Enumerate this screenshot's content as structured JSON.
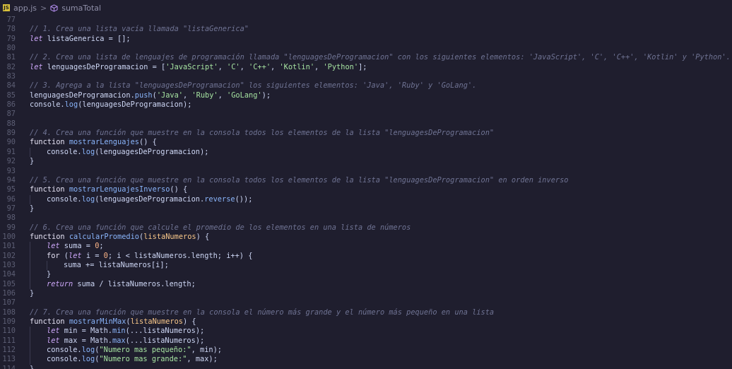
{
  "breadcrumb": {
    "file_icon": "JS",
    "file": "app.js",
    "separator": ">",
    "symbol": "sumaTotal"
  },
  "lines": [
    {
      "n": "77",
      "indent": 0,
      "tokens": []
    },
    {
      "n": "78",
      "indent": 0,
      "tokens": [
        {
          "t": "// 1. Crea una lista vacía llamada \"listaGenerica\"",
          "c": "comment"
        }
      ]
    },
    {
      "n": "79",
      "indent": 0,
      "tokens": [
        {
          "t": "let",
          "c": "kw"
        },
        {
          "t": " listaGenerica = [];",
          "c": "txt"
        }
      ]
    },
    {
      "n": "80",
      "indent": 0,
      "tokens": []
    },
    {
      "n": "81",
      "indent": 0,
      "tokens": [
        {
          "t": "// 2. Crea una lista de lenguajes de programación llamada \"lenguagesDeProgramacion\" con los siguientes elementos: 'JavaScript', 'C', 'C++', 'Kotlin' y 'Python'.",
          "c": "comment"
        }
      ]
    },
    {
      "n": "82",
      "indent": 0,
      "tokens": [
        {
          "t": "let",
          "c": "kw"
        },
        {
          "t": " lenguagesDeProgramacion = [",
          "c": "txt"
        },
        {
          "t": "'JavaScript'",
          "c": "str"
        },
        {
          "t": ", ",
          "c": "txt"
        },
        {
          "t": "'C'",
          "c": "str"
        },
        {
          "t": ", ",
          "c": "txt"
        },
        {
          "t": "'C++'",
          "c": "str"
        },
        {
          "t": ", ",
          "c": "txt"
        },
        {
          "t": "'Kotlin'",
          "c": "str"
        },
        {
          "t": ", ",
          "c": "txt"
        },
        {
          "t": "'Python'",
          "c": "str"
        },
        {
          "t": "];",
          "c": "txt"
        }
      ]
    },
    {
      "n": "83",
      "indent": 0,
      "tokens": []
    },
    {
      "n": "84",
      "indent": 0,
      "tokens": [
        {
          "t": "// 3. Agrega a la lista \"lenguagesDeProgramacion\" los siguientes elementos: 'Java', 'Ruby' y 'GoLang'.",
          "c": "comment"
        }
      ]
    },
    {
      "n": "85",
      "indent": 0,
      "tokens": [
        {
          "t": "lenguagesDeProgramacion.",
          "c": "txt"
        },
        {
          "t": "push",
          "c": "method"
        },
        {
          "t": "(",
          "c": "txt"
        },
        {
          "t": "'Java'",
          "c": "str"
        },
        {
          "t": ", ",
          "c": "txt"
        },
        {
          "t": "'Ruby'",
          "c": "str"
        },
        {
          "t": ", ",
          "c": "txt"
        },
        {
          "t": "'GoLang'",
          "c": "str"
        },
        {
          "t": ");",
          "c": "txt"
        }
      ]
    },
    {
      "n": "86",
      "indent": 0,
      "tokens": [
        {
          "t": "console.",
          "c": "txt"
        },
        {
          "t": "log",
          "c": "method"
        },
        {
          "t": "(lenguagesDeProgramacion);",
          "c": "txt"
        }
      ]
    },
    {
      "n": "87",
      "indent": 0,
      "tokens": []
    },
    {
      "n": "88",
      "indent": 0,
      "tokens": []
    },
    {
      "n": "89",
      "indent": 0,
      "tokens": [
        {
          "t": "// 4. Crea una función que muestre en la consola todos los elementos de la lista \"lenguagesDeProgramacion\"",
          "c": "comment"
        }
      ]
    },
    {
      "n": "90",
      "indent": 0,
      "tokens": [
        {
          "t": "function",
          "c": "kw-plain"
        },
        {
          "t": " ",
          "c": "txt"
        },
        {
          "t": "mostrarLenguajes",
          "c": "fn"
        },
        {
          "t": "() {",
          "c": "txt"
        }
      ]
    },
    {
      "n": "91",
      "indent": 1,
      "tokens": [
        {
          "t": "console.",
          "c": "txt"
        },
        {
          "t": "log",
          "c": "method"
        },
        {
          "t": "(lenguagesDeProgramacion);",
          "c": "txt"
        }
      ]
    },
    {
      "n": "92",
      "indent": 0,
      "tokens": [
        {
          "t": "}",
          "c": "txt"
        }
      ]
    },
    {
      "n": "93",
      "indent": 0,
      "tokens": []
    },
    {
      "n": "94",
      "indent": 0,
      "tokens": [
        {
          "t": "// 5. Crea una función que muestre en la consola todos los elementos de la lista \"lenguagesDeProgramacion\" en orden inverso",
          "c": "comment"
        }
      ]
    },
    {
      "n": "95",
      "indent": 0,
      "tokens": [
        {
          "t": "function",
          "c": "kw-plain"
        },
        {
          "t": " ",
          "c": "txt"
        },
        {
          "t": "mostrarLenguajesInverso",
          "c": "fn"
        },
        {
          "t": "() {",
          "c": "txt"
        }
      ]
    },
    {
      "n": "96",
      "indent": 1,
      "tokens": [
        {
          "t": "console.",
          "c": "txt"
        },
        {
          "t": "log",
          "c": "method"
        },
        {
          "t": "(lenguagesDeProgramacion.",
          "c": "txt"
        },
        {
          "t": "reverse",
          "c": "method"
        },
        {
          "t": "());",
          "c": "txt"
        }
      ]
    },
    {
      "n": "97",
      "indent": 0,
      "tokens": [
        {
          "t": "}",
          "c": "txt"
        }
      ]
    },
    {
      "n": "98",
      "indent": 0,
      "tokens": []
    },
    {
      "n": "99",
      "indent": 0,
      "tokens": [
        {
          "t": "// 6. Crea una función que calcule el promedio de los elementos en una lista de números",
          "c": "comment"
        }
      ]
    },
    {
      "n": "100",
      "indent": 0,
      "tokens": [
        {
          "t": "function",
          "c": "kw-plain"
        },
        {
          "t": " ",
          "c": "txt"
        },
        {
          "t": "calcularPromedio",
          "c": "fn"
        },
        {
          "t": "(",
          "c": "txt"
        },
        {
          "t": "listaNumeros",
          "c": "param"
        },
        {
          "t": ") {",
          "c": "txt"
        }
      ]
    },
    {
      "n": "101",
      "indent": 1,
      "tokens": [
        {
          "t": "let",
          "c": "kw"
        },
        {
          "t": " suma = ",
          "c": "txt"
        },
        {
          "t": "0",
          "c": "num"
        },
        {
          "t": ";",
          "c": "txt"
        }
      ]
    },
    {
      "n": "102",
      "indent": 1,
      "tokens": [
        {
          "t": "for",
          "c": "kw-plain"
        },
        {
          "t": " (",
          "c": "txt"
        },
        {
          "t": "let",
          "c": "kw"
        },
        {
          "t": " i = ",
          "c": "txt"
        },
        {
          "t": "0",
          "c": "num"
        },
        {
          "t": "; i < listaNumeros.length; i++) {",
          "c": "txt"
        }
      ]
    },
    {
      "n": "103",
      "indent": 2,
      "tokens": [
        {
          "t": "suma += listaNumeros[i];",
          "c": "txt"
        }
      ]
    },
    {
      "n": "104",
      "indent": 1,
      "tokens": [
        {
          "t": "}",
          "c": "txt"
        }
      ]
    },
    {
      "n": "105",
      "indent": 1,
      "tokens": [
        {
          "t": "return",
          "c": "kw"
        },
        {
          "t": " suma / listaNumeros.length;",
          "c": "txt"
        }
      ]
    },
    {
      "n": "106",
      "indent": 0,
      "tokens": [
        {
          "t": "}",
          "c": "txt"
        }
      ]
    },
    {
      "n": "107",
      "indent": 0,
      "tokens": []
    },
    {
      "n": "108",
      "indent": 0,
      "tokens": [
        {
          "t": "// 7. Crea una función que muestre en la consola el número más grande y el número más pequeño en una lista",
          "c": "comment"
        }
      ]
    },
    {
      "n": "109",
      "indent": 0,
      "tokens": [
        {
          "t": "function",
          "c": "kw-plain"
        },
        {
          "t": " ",
          "c": "txt"
        },
        {
          "t": "mostrarMinMax",
          "c": "fn"
        },
        {
          "t": "(",
          "c": "txt"
        },
        {
          "t": "listaNumeros",
          "c": "param"
        },
        {
          "t": ") {",
          "c": "txt"
        }
      ]
    },
    {
      "n": "110",
      "indent": 1,
      "tokens": [
        {
          "t": "let",
          "c": "kw"
        },
        {
          "t": " min = Math.",
          "c": "txt"
        },
        {
          "t": "min",
          "c": "method"
        },
        {
          "t": "(...listaNumeros);",
          "c": "txt"
        }
      ]
    },
    {
      "n": "111",
      "indent": 1,
      "tokens": [
        {
          "t": "let",
          "c": "kw"
        },
        {
          "t": " max = Math.",
          "c": "txt"
        },
        {
          "t": "max",
          "c": "method"
        },
        {
          "t": "(...listaNumeros);",
          "c": "txt"
        }
      ]
    },
    {
      "n": "112",
      "indent": 1,
      "tokens": [
        {
          "t": "console.",
          "c": "txt"
        },
        {
          "t": "log",
          "c": "method"
        },
        {
          "t": "(",
          "c": "txt"
        },
        {
          "t": "\"Numero mas pequeño:\"",
          "c": "str"
        },
        {
          "t": ", min);",
          "c": "txt"
        }
      ]
    },
    {
      "n": "113",
      "indent": 1,
      "tokens": [
        {
          "t": "console.",
          "c": "txt"
        },
        {
          "t": "log",
          "c": "method"
        },
        {
          "t": "(",
          "c": "txt"
        },
        {
          "t": "\"Numero mas grande:\"",
          "c": "str"
        },
        {
          "t": ", max);",
          "c": "txt"
        }
      ]
    },
    {
      "n": "114",
      "indent": 0,
      "tokens": [
        {
          "t": "}",
          "c": "txt"
        }
      ]
    }
  ]
}
